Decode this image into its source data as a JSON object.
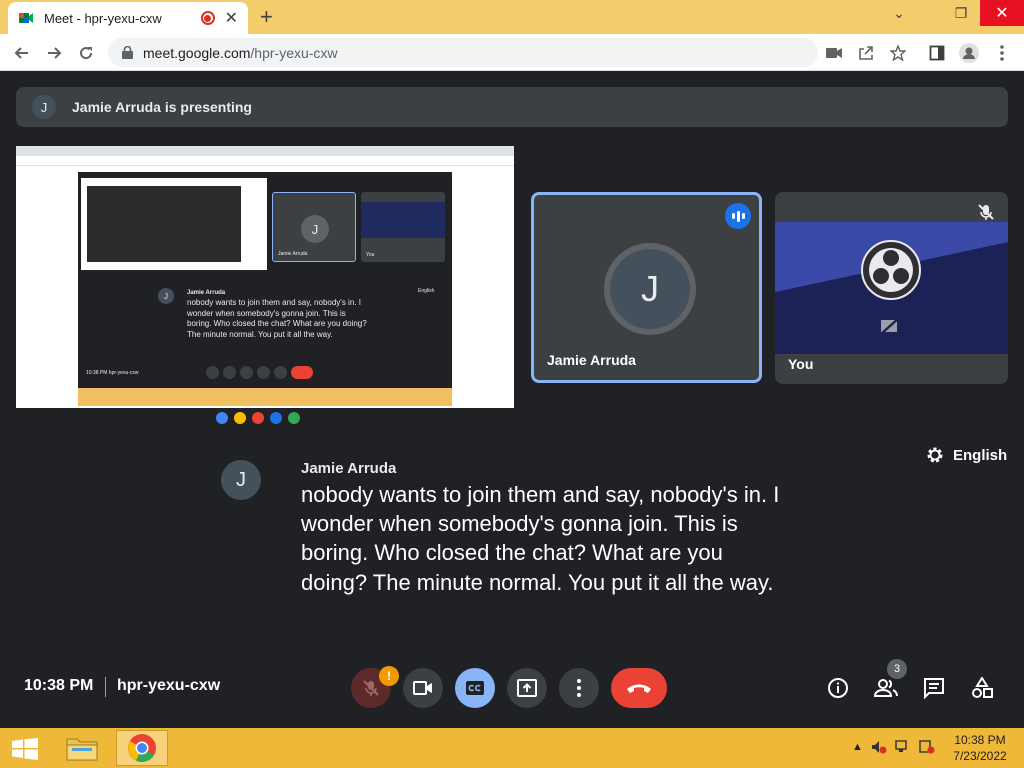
{
  "browser": {
    "tab_title": "Meet - hpr-yexu-cxw",
    "url_host": "meet.google.com",
    "url_path": "/hpr-yexu-cxw",
    "new_tab_symbol": "+",
    "minimize_symbol": "⌄",
    "maximize_symbol": "❐",
    "close_symbol": "✕"
  },
  "banner": {
    "avatar_letter": "J",
    "text": "Jamie Arruda is presenting"
  },
  "presentation": {
    "caption_name": "Jamie Arruda",
    "caption_text": "nobody wants to join them and say, nobody's in. I wonder when somebody's gonna join. This is boring. Who closed the chat? What are you doing? The minute normal. You put it all the way.",
    "language": "English",
    "tile1_name": "Jamie Arruda",
    "tile2_name": "You",
    "avatar_letter": "J",
    "footer": "10:38 PM   hpr-yexu-cxw"
  },
  "participants": {
    "main": {
      "name": "Jamie Arruda",
      "avatar_letter": "J"
    },
    "self": {
      "name": "You"
    }
  },
  "caption": {
    "avatar_letter": "J",
    "name": "Jamie Arruda",
    "text": "nobody wants to join them and say, nobody's in. I wonder when somebody's gonna join. This is boring. Who closed the chat? What are you doing? The minute normal. You put it all the way."
  },
  "caption_language": "English",
  "meeting": {
    "time": "10:38 PM",
    "code": "hpr-yexu-cxw",
    "people_count": "3",
    "mic_warning": "!"
  },
  "taskbar": {
    "clock_time": "10:38 PM",
    "clock_date": "7/23/2022"
  },
  "colors": {
    "tabstrip": "#f3cd6c",
    "meet_bg": "#202124",
    "tile_bg": "#3c4043",
    "accent_blue": "#8ab4f8",
    "end_call_red": "#ea4335",
    "taskbar": "#f0b838"
  }
}
